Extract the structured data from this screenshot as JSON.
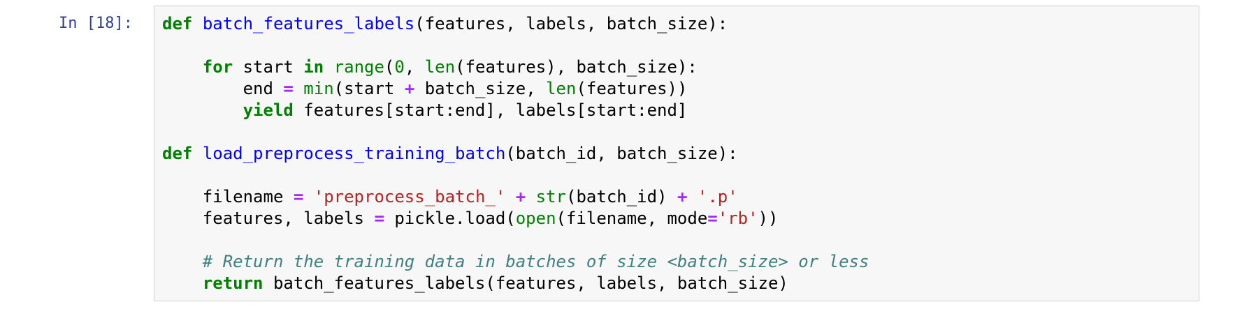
{
  "cell": {
    "prompt": "In [18]:"
  },
  "code": {
    "l1": {
      "kw": "def",
      "name": "batch_features_labels",
      "rest": "(features, labels, batch_size):"
    },
    "l3": {
      "indent": "    ",
      "kw_for": "for",
      "var": " start ",
      "kw_in": "in",
      "range": "range",
      "p1": "(",
      "zero": "0",
      "p2": ", ",
      "len": "len",
      "p3": "(features), batch_size):"
    },
    "l4": {
      "indent": "        ",
      "a": "end ",
      "eq": "=",
      "sp": " ",
      "min": "min",
      "b": "(start ",
      "plus": "+",
      "c": " batch_size, ",
      "len": "len",
      "d": "(features))"
    },
    "l5": {
      "indent": "        ",
      "kw": "yield",
      "rest": " features[start:end], labels[start:end]"
    },
    "l7": {
      "kw": "def",
      "name": "load_preprocess_training_batch",
      "rest": "(batch_id, batch_size):"
    },
    "l9": {
      "indent": "    ",
      "a": "filename ",
      "eq": "=",
      "sp": " ",
      "s1": "'preprocess_batch_'",
      "sp2": " ",
      "plus1": "+",
      "sp3": " ",
      "str": "str",
      "b": "(batch_id) ",
      "plus2": "+",
      "sp4": " ",
      "s2": "'.p'"
    },
    "l10": {
      "indent": "    ",
      "a": "features, labels ",
      "eq": "=",
      "b": " pickle.load(",
      "open": "open",
      "c": "(filename, mode",
      "eq2": "=",
      "s": "'rb'",
      "d": "))"
    },
    "l12": {
      "indent": "    ",
      "comment": "# Return the training data in batches of size <batch_size> or less"
    },
    "l13": {
      "indent": "    ",
      "kw": "return",
      "rest": " batch_features_labels(features, labels, batch_size)"
    }
  }
}
